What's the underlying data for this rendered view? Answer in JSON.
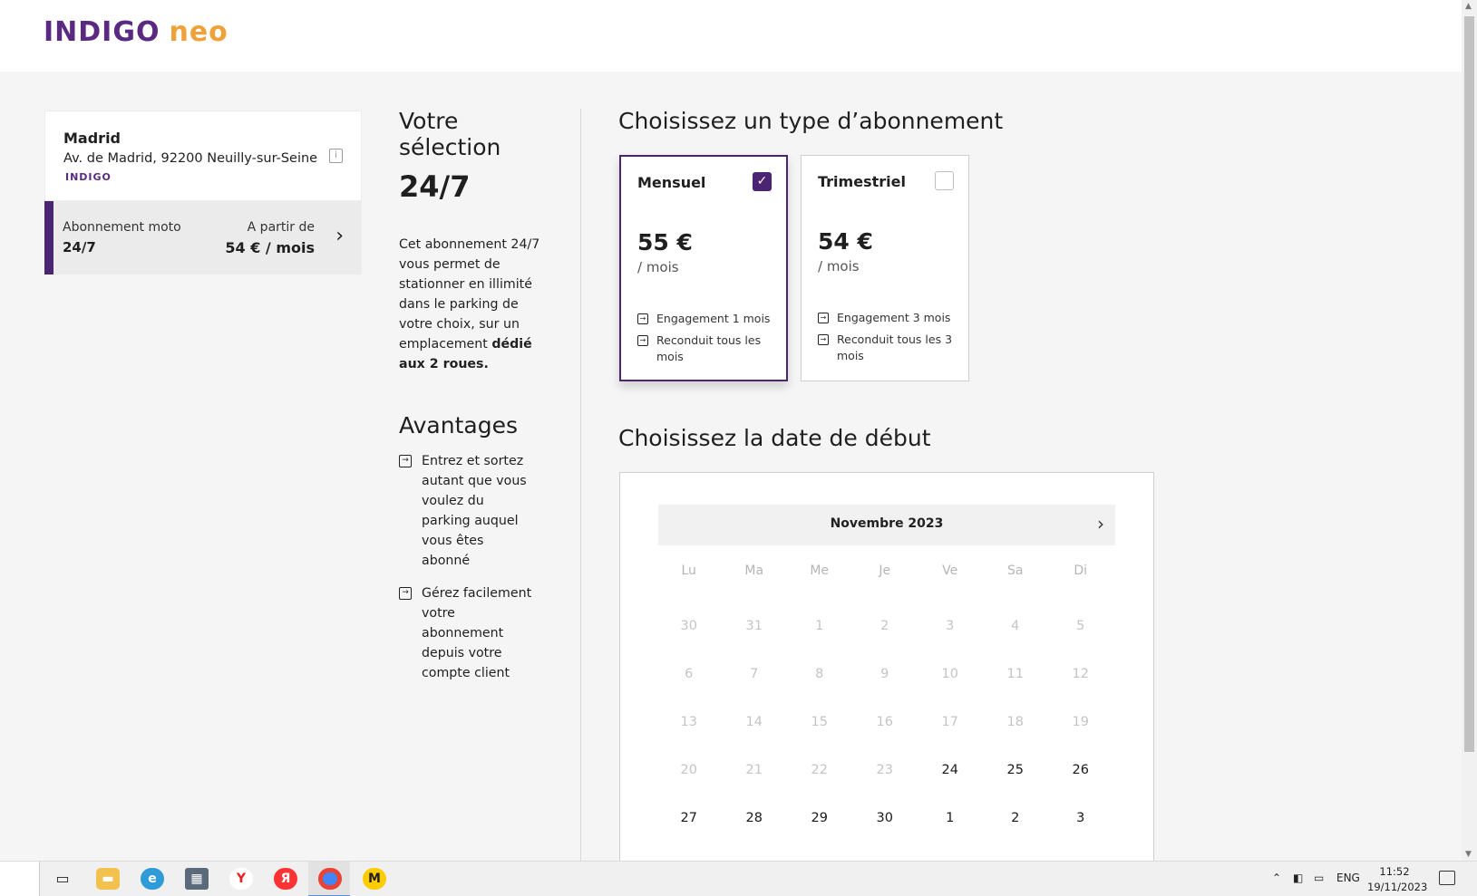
{
  "header": {
    "logo_main": "INDIGO",
    "logo_sub": "neo"
  },
  "parking": {
    "name": "Madrid",
    "address": "Av. de Madrid, 92200 Neuilly-sur-Seine",
    "brand": "INDIGO"
  },
  "subscription": {
    "type": "Abonnement moto",
    "name": "24/7",
    "from_label": "A partir de",
    "price": "54 € / mois"
  },
  "selection": {
    "title": "Votre sélection",
    "plan": "24/7",
    "desc_plain": "Cet abonnement 24/7 vous permet de stationner en illimité dans le parking de votre choix, sur un emplacement",
    "desc_bold": "dédié aux 2 roues.",
    "advantages_title": "Avantages",
    "advantages": [
      "Entrez et sortez autant que vous voulez du parking auquel vous êtes abonné",
      "Gérez facilement votre abonnement depuis votre compte client"
    ]
  },
  "plans": {
    "heading": "Choisissez un type d’abonnement",
    "items": [
      {
        "name": "Mensuel",
        "price": "55 €",
        "unit": "/ mois",
        "features": [
          "Engagement 1 mois",
          "Reconduit tous les mois"
        ],
        "selected": true
      },
      {
        "name": "Trimestriel",
        "price": "54 €",
        "unit": "/ mois",
        "features": [
          "Engagement 3 mois",
          "Reconduit tous les 3 mois"
        ],
        "selected": false
      }
    ]
  },
  "calendar": {
    "heading": "Choisissez la date de début",
    "month": "Novembre 2023",
    "weekdays": [
      "Lu",
      "Ma",
      "Me",
      "Je",
      "Ve",
      "Sa",
      "Di"
    ],
    "weeks": [
      [
        "30",
        "31",
        "1",
        "2",
        "3",
        "4",
        "5"
      ],
      [
        "6",
        "7",
        "8",
        "9",
        "10",
        "11",
        "12"
      ],
      [
        "13",
        "14",
        "15",
        "16",
        "17",
        "18",
        "19"
      ],
      [
        "20",
        "21",
        "22",
        "23",
        "24",
        "25",
        "26"
      ],
      [
        "27",
        "28",
        "29",
        "30",
        "1",
        "2",
        "3"
      ]
    ],
    "first_available": "24"
  },
  "taskbar": {
    "lang": "ENG",
    "time": "11:52",
    "date": "19/11/2023",
    "apps": [
      "task-view-icon",
      "file-explorer-icon",
      "edge-icon",
      "calculator-icon",
      "yandex-browser-icon",
      "yandex-icon",
      "chrome-icon",
      "yandex-market-icon"
    ]
  },
  "colors": {
    "brand_purple": "#4b2474",
    "brand_orange": "#f0a23a"
  }
}
